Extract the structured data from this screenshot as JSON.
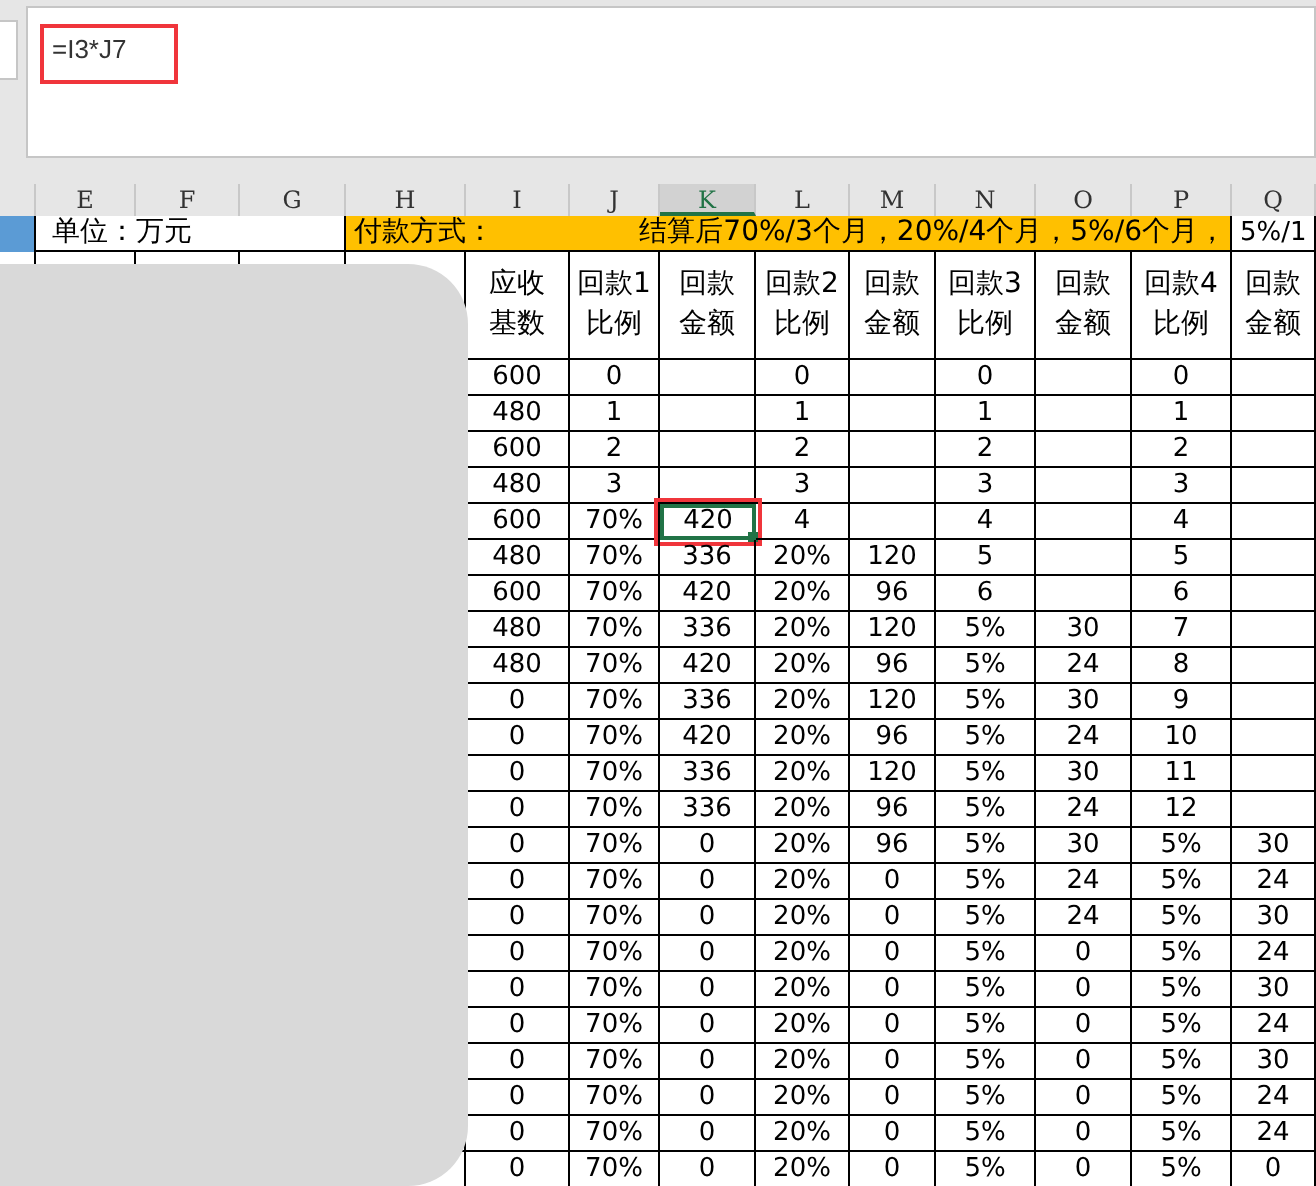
{
  "formula_bar": {
    "formula": "=I3*J7"
  },
  "column_headers": [
    {
      "label": "E",
      "selected": false
    },
    {
      "label": "F",
      "selected": false
    },
    {
      "label": "G",
      "selected": false
    },
    {
      "label": "H",
      "selected": false
    },
    {
      "label": "I",
      "selected": false
    },
    {
      "label": "J",
      "selected": false
    },
    {
      "label": "K",
      "selected": true
    },
    {
      "label": "L",
      "selected": false
    },
    {
      "label": "M",
      "selected": false
    },
    {
      "label": "N",
      "selected": false
    },
    {
      "label": "O",
      "selected": false
    },
    {
      "label": "P",
      "selected": false
    },
    {
      "label": "Q",
      "selected": false
    }
  ],
  "unit_label": "单位：万元",
  "payment_label": "付款方式：",
  "payment_terms": "结算后70%/3个月，20%/4个月，5%/6个月，",
  "payment_terms_overflow": "5%/1",
  "table": {
    "columns": [
      {
        "top": "应收",
        "bottom": "基数"
      },
      {
        "top": "回款1",
        "bottom": "比例"
      },
      {
        "top": "回款",
        "bottom": "金额"
      },
      {
        "top": "回款2",
        "bottom": "比例"
      },
      {
        "top": "回款",
        "bottom": "金额"
      },
      {
        "top": "回款3",
        "bottom": "比例"
      },
      {
        "top": "回款",
        "bottom": "金额"
      },
      {
        "top": "回款4",
        "bottom": "比例"
      },
      {
        "top": "回款",
        "bottom": "金额"
      }
    ],
    "rows": [
      {
        "selected": false,
        "cells": [
          "600",
          "0",
          null,
          "0",
          null,
          "0",
          null,
          "0",
          null
        ]
      },
      {
        "selected": false,
        "cells": [
          "480",
          "1",
          null,
          "1",
          null,
          "1",
          null,
          "1",
          null
        ]
      },
      {
        "selected": false,
        "cells": [
          "600",
          "2",
          null,
          "2",
          null,
          "2",
          null,
          "2",
          null
        ]
      },
      {
        "selected": false,
        "cells": [
          "480",
          "3",
          null,
          "3",
          null,
          "3",
          null,
          "3",
          null
        ]
      },
      {
        "selected": true,
        "cells": [
          "600",
          "70%",
          "420",
          "4",
          null,
          "4",
          null,
          "4",
          null
        ]
      },
      {
        "selected": false,
        "cells": [
          "480",
          "70%",
          "336",
          "20%",
          "120",
          "5",
          null,
          "5",
          null
        ]
      },
      {
        "selected": false,
        "cells": [
          "600",
          "70%",
          "420",
          "20%",
          "96",
          "6",
          null,
          "6",
          null
        ]
      },
      {
        "selected": false,
        "cells": [
          "480",
          "70%",
          "336",
          "20%",
          "120",
          "5%",
          "30",
          "7",
          null
        ]
      },
      {
        "selected": false,
        "cells": [
          "480",
          "70%",
          "420",
          "20%",
          "96",
          "5%",
          "24",
          "8",
          null
        ]
      },
      {
        "selected": false,
        "cells": [
          "0",
          "70%",
          "336",
          "20%",
          "120",
          "5%",
          "30",
          "9",
          null
        ]
      },
      {
        "selected": false,
        "cells": [
          "0",
          "70%",
          "420",
          "20%",
          "96",
          "5%",
          "24",
          "10",
          null
        ]
      },
      {
        "selected": false,
        "cells": [
          "0",
          "70%",
          "336",
          "20%",
          "120",
          "5%",
          "30",
          "11",
          null
        ]
      },
      {
        "selected": false,
        "cells": [
          "0",
          "70%",
          "336",
          "20%",
          "96",
          "5%",
          "24",
          "12",
          null
        ]
      },
      {
        "selected": false,
        "cells": [
          "0",
          "70%",
          "0",
          "20%",
          "96",
          "5%",
          "30",
          "5%",
          "30"
        ]
      },
      {
        "selected": false,
        "cells": [
          "0",
          "70%",
          "0",
          "20%",
          "0",
          "5%",
          "24",
          "5%",
          "24"
        ]
      },
      {
        "selected": false,
        "cells": [
          "0",
          "70%",
          "0",
          "20%",
          "0",
          "5%",
          "24",
          "5%",
          "30"
        ]
      },
      {
        "selected": false,
        "cells": [
          "0",
          "70%",
          "0",
          "20%",
          "0",
          "5%",
          "0",
          "5%",
          "24"
        ]
      },
      {
        "selected": false,
        "cells": [
          "0",
          "70%",
          "0",
          "20%",
          "0",
          "5%",
          "0",
          "5%",
          "30"
        ]
      },
      {
        "selected": false,
        "cells": [
          "0",
          "70%",
          "0",
          "20%",
          "0",
          "5%",
          "0",
          "5%",
          "24"
        ]
      },
      {
        "selected": false,
        "cells": [
          "0",
          "70%",
          "0",
          "20%",
          "0",
          "5%",
          "0",
          "5%",
          "30"
        ]
      },
      {
        "selected": false,
        "cells": [
          "0",
          "70%",
          "0",
          "20%",
          "0",
          "5%",
          "0",
          "5%",
          "24"
        ]
      },
      {
        "selected": false,
        "cells": [
          "0",
          "70%",
          "0",
          "20%",
          "0",
          "5%",
          "0",
          "5%",
          "24"
        ]
      },
      {
        "selected": false,
        "cells": [
          "0",
          "70%",
          "0",
          "20%",
          "0",
          "5%",
          "0",
          "5%",
          "0"
        ]
      }
    ]
  }
}
